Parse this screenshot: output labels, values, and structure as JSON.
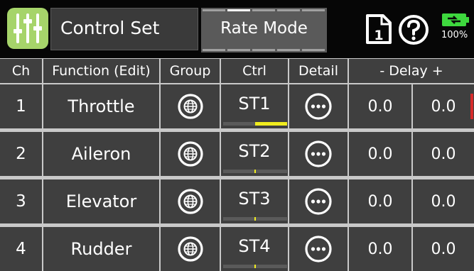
{
  "header": {
    "app_icon": "mixer-sliders-icon",
    "title": "Control Set",
    "mode_button": "Rate Mode",
    "model_icon": "model-1-icon",
    "model_number": "1",
    "help_icon": "help-icon",
    "battery_icon": "battery-charging-icon",
    "battery_percent": "100%"
  },
  "columns": [
    "Ch",
    "Function (Edit)",
    "Group",
    "Ctrl",
    "Detail",
    "- Delay +"
  ],
  "rows": [
    {
      "ch": "1",
      "function": "Throttle",
      "group_icon": "globe-icon",
      "ctrl": "ST1",
      "detail_icon": "more-icon",
      "delay_down": "0.0",
      "delay_up": "0.0",
      "ctrl_level": 0.5
    },
    {
      "ch": "2",
      "function": "Aileron",
      "group_icon": "globe-icon",
      "ctrl": "ST2",
      "detail_icon": "more-icon",
      "delay_down": "0.0",
      "delay_up": "0.0",
      "ctrl_level": 0.0
    },
    {
      "ch": "3",
      "function": "Elevator",
      "group_icon": "globe-icon",
      "ctrl": "ST3",
      "detail_icon": "more-icon",
      "delay_down": "0.0",
      "delay_up": "0.0",
      "ctrl_level": 0.0
    },
    {
      "ch": "4",
      "function": "Rudder",
      "group_icon": "globe-icon",
      "ctrl": "ST4",
      "detail_icon": "more-icon",
      "delay_down": "0.0",
      "delay_up": "0.0",
      "ctrl_level": 0.0
    }
  ],
  "colors": {
    "header_bg": "#060606",
    "cell_bg": "#3f3f3f",
    "accent_green": "#a6d46a",
    "ctrl_indicator": "#f0ec1e",
    "selection_marker": "#d62a2a",
    "battery_green": "#3ed83e"
  }
}
